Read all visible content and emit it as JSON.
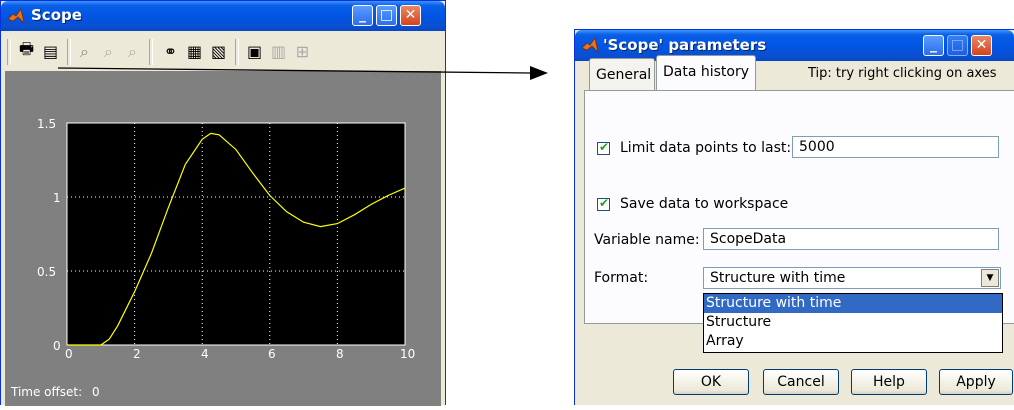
{
  "scope_window": {
    "title": "Scope",
    "time_offset_label": "Time offset:",
    "time_offset_value": "0"
  },
  "plot": {
    "x_ticks": [
      "0",
      "2",
      "4",
      "6",
      "8",
      "10"
    ],
    "y_ticks": [
      "0",
      "0.5",
      "1",
      "1.5"
    ],
    "xlim": [
      0,
      10
    ],
    "ylim": [
      0,
      1.5
    ],
    "line_color": "#ffff00",
    "background": "#000000",
    "curve": [
      [
        0,
        0
      ],
      [
        1.0,
        0
      ],
      [
        1.25,
        0.04
      ],
      [
        1.5,
        0.13
      ],
      [
        2,
        0.36
      ],
      [
        2.5,
        0.62
      ],
      [
        3,
        0.93
      ],
      [
        3.5,
        1.22
      ],
      [
        4,
        1.39
      ],
      [
        4.25,
        1.43
      ],
      [
        4.5,
        1.42
      ],
      [
        5,
        1.32
      ],
      [
        5.5,
        1.16
      ],
      [
        6,
        1.01
      ],
      [
        6.5,
        0.9
      ],
      [
        7,
        0.83
      ],
      [
        7.5,
        0.8
      ],
      [
        8,
        0.82
      ],
      [
        8.5,
        0.88
      ],
      [
        9,
        0.95
      ],
      [
        9.5,
        1.01
      ],
      [
        10,
        1.06
      ]
    ]
  },
  "params_window": {
    "title": "'Scope' parameters",
    "tabs": [
      "General",
      "Data history"
    ],
    "tip": "Tip: try right clicking on axes",
    "limit_label": "Limit data points to last:",
    "limit_checked": true,
    "limit_value": "5000",
    "save_label": "Save data to workspace",
    "save_checked": true,
    "varname_label": "Variable name:",
    "varname_value": "ScopeData",
    "format_label": "Format:",
    "format_value": "Structure with time",
    "format_options": [
      "Structure with time",
      "Structure",
      "Array"
    ],
    "buttons": {
      "ok": "OK",
      "cancel": "Cancel",
      "help": "Help",
      "apply": "Apply"
    }
  },
  "colors": {
    "title_bar": "#0055e5",
    "accent": "#316ac5",
    "arrow": "#000000"
  }
}
